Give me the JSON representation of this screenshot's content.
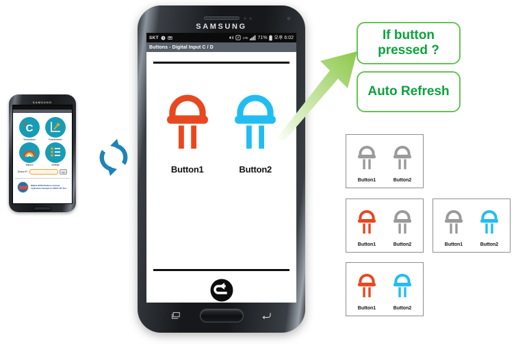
{
  "colors": {
    "led_on_1": "#E8471F",
    "led_on_2": "#22BDF0",
    "led_off": "#9A9A9A",
    "callout_border": "#66C254",
    "callout_text": "#0AA33C",
    "sync_icon": "#1F83B5",
    "arrow_green": "#8CC63F",
    "small_phone_accent": "#189CB5"
  },
  "small_phone": {
    "brand": "SAMSUNG",
    "grid": [
      {
        "label": "Temperature",
        "icon": "temperature-icon"
      },
      {
        "label": "Potentiometer",
        "icon": "potentiometer-icon"
      },
      {
        "label": "Buttons",
        "icon": "buttons-icon"
      },
      {
        "label": "Settings",
        "icon": "settings-icon"
      }
    ],
    "device_ip_label": "Device IP:",
    "device_ip_value": "",
    "device_ip_placeholder": "",
    "go_button": "GO",
    "footer_text": "MQbile M7500 Platform Android Application Example for BEST API Test"
  },
  "sync_icon": {
    "name": "sync-arrows-icon"
  },
  "big_phone": {
    "brand": "SAMSUNG",
    "status_bar": {
      "carrier": "SKT",
      "clock_icon": "alarm-clock-icon",
      "sd_icon": "sd-card-icon",
      "mute_icon": "vibrate-icon",
      "nfc_icon": "nfc-icon",
      "network_type": "LTE",
      "signal_icon": "signal-bars-icon",
      "battery_percent": "71%",
      "battery_icon": "battery-icon",
      "time": "오후 6:02"
    },
    "title": "Buttons - Digital Input C / D",
    "leds": [
      {
        "label": "Button1",
        "state": "on",
        "color": "#E8471F"
      },
      {
        "label": "Button2",
        "state": "on",
        "color": "#22BDF0"
      }
    ],
    "refresh_button": {
      "name": "refresh-button",
      "label": ""
    },
    "nav": {
      "recents": "recents-icon",
      "home": "home-button",
      "back": "back-icon"
    }
  },
  "green_arrow": {
    "name": "green-arrow-icon"
  },
  "callouts": {
    "if_pressed": "If button\npressed ?",
    "if_pressed_line1": "If button",
    "if_pressed_line2": "pressed ?",
    "auto_refresh": "Auto Refresh"
  },
  "led_panels": [
    {
      "id": "panel-a",
      "leds": [
        {
          "label": "Button1",
          "state": "off",
          "color": "#9A9A9A"
        },
        {
          "label": "Button2",
          "state": "off",
          "color": "#9A9A9A"
        }
      ]
    },
    {
      "id": "panel-b",
      "leds": [
        {
          "label": "Button1",
          "state": "on",
          "color": "#E8471F"
        },
        {
          "label": "Button2",
          "state": "off",
          "color": "#9A9A9A"
        }
      ]
    },
    {
      "id": "panel-c",
      "leds": [
        {
          "label": "Button1",
          "state": "off",
          "color": "#9A9A9A"
        },
        {
          "label": "Button2",
          "state": "on",
          "color": "#22BDF0"
        }
      ]
    },
    {
      "id": "panel-d",
      "leds": [
        {
          "label": "Button1",
          "state": "on",
          "color": "#E8471F"
        },
        {
          "label": "Button2",
          "state": "on",
          "color": "#22BDF0"
        }
      ]
    }
  ]
}
